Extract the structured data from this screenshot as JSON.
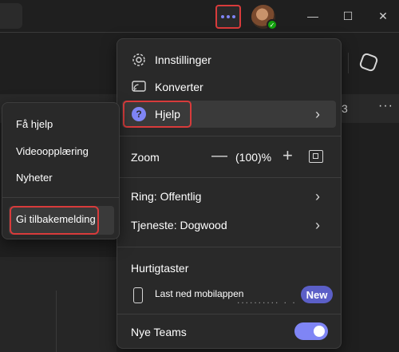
{
  "titlebar": {
    "more_icon": "more-horizontal-icon",
    "status": "available",
    "accent": "#7f85f5",
    "highlight": "#d83b3b"
  },
  "background": {
    "visible_number": "3"
  },
  "menu": {
    "settings_label": "Innstillinger",
    "convert_label": "Konverter",
    "help_label": "Hjelp",
    "zoom_label": "Zoom",
    "zoom_value": "(100)%",
    "ring_label": "Ring: Offentlig",
    "service_label": "Tjeneste: Dogwood",
    "shortcuts_label": "Hurtigtaster",
    "mobile_label": "Last ned mobilappen",
    "new_badge": "New",
    "new_teams_label": "Nye Teams",
    "new_teams_enabled": true
  },
  "submenu": {
    "items": [
      "Få hjelp",
      "Videoopplæring",
      "Nyheter"
    ],
    "feedback_label": "Gi tilbakemelding"
  }
}
